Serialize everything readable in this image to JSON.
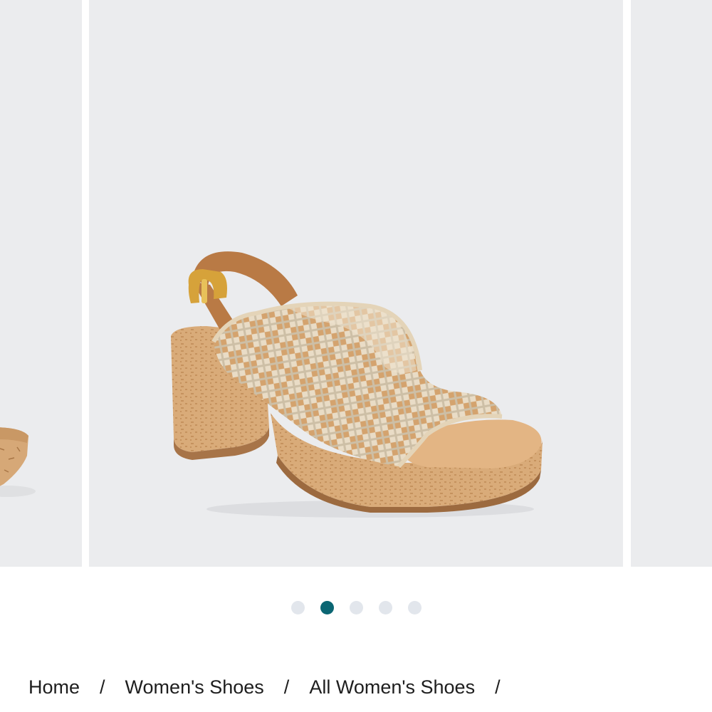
{
  "carousel": {
    "active_index": 1,
    "slide_count": 5,
    "product_image_alt": "Woven platform slingback sandal with cork heel",
    "zoom_icon": "search-icon"
  },
  "breadcrumb": {
    "items": [
      "Home",
      "Women's Shoes",
      "All Women's Shoes"
    ],
    "separator": "/"
  },
  "colors": {
    "slide_background": "#ebecee",
    "dot_active": "#0b6673",
    "dot_inactive": "#e2e6ec",
    "cork": "#d6a877",
    "strap": "#b97a45",
    "weave": "#e6d9c3"
  }
}
